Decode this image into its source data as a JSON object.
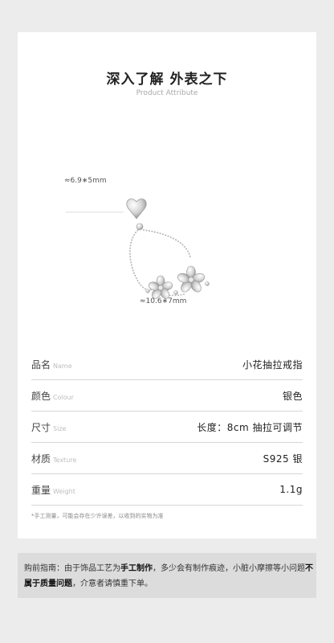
{
  "header": {
    "title": "深入了解 外表之下",
    "subtitle": "Product Attribute"
  },
  "dimensions": {
    "top": "≈6.9∗5mm",
    "bottom": "≈10.6∗7mm"
  },
  "attributes": [
    {
      "label": "品名",
      "label_en": "Name",
      "value": "小花抽拉戒指"
    },
    {
      "label": "颜色",
      "label_en": "Colour",
      "value": "银色"
    },
    {
      "label": "尺寸",
      "label_en": "Size",
      "value": "长度：8cm 抽拉可调节"
    },
    {
      "label": "材质",
      "label_en": "Texture",
      "value": "S925 银"
    },
    {
      "label": "重量",
      "label_en": "Weight",
      "value": "1.1g"
    }
  ],
  "note": "*手工测量，可能会存在少许误差，以收到的实物为准",
  "notice": {
    "part1": "购前指南：由于饰品工艺为",
    "bold1": "手工制作",
    "part2": "，多少会有制作痕迹，小脏小摩擦等小问题",
    "bold2": "不属于质量问题",
    "part3": "，介意者请慎重下单。"
  },
  "colors": {
    "background": "#ececec",
    "card": "#ffffff",
    "notice_bg": "#dcdcdc",
    "silver": "#c9c9c9"
  }
}
